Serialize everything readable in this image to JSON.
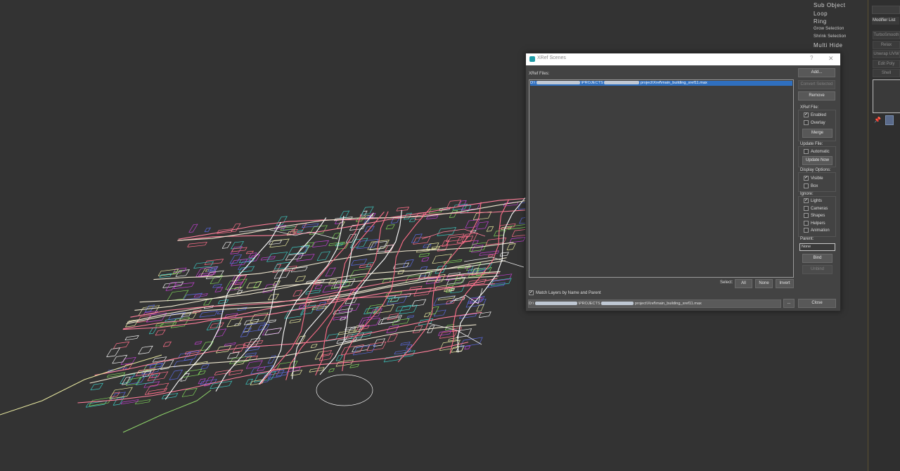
{
  "dialog": {
    "title": "XRef Scenes",
    "help": "?",
    "close_glyph": "✕",
    "files_label": "XRef Files:",
    "file_row": {
      "prefix": "D:\\",
      "segment_a": "\\PROJECTS",
      "suffix": "project\\Xref\\main_building_xref11.max"
    },
    "buttons": {
      "add": "Add...",
      "convert": "Convert Selected",
      "remove": "Remove",
      "merge": "Merge",
      "update_now": "Update Now",
      "bind": "Bind",
      "unbind": "Unbind",
      "all": "All",
      "none": "None",
      "invert": "Invert",
      "browse": "...",
      "close": "Close"
    },
    "xref_file": {
      "label": "XRef File:",
      "enabled": {
        "label": "Enabled",
        "checked": true
      },
      "overlay": {
        "label": "Overlay",
        "checked": false
      }
    },
    "update_file": {
      "label": "Update File:",
      "automatic": {
        "label": "Automatic",
        "checked": false
      }
    },
    "display_options": {
      "label": "Display Options:",
      "visible": {
        "label": "Visible",
        "checked": true
      },
      "box": {
        "label": "Box",
        "checked": false
      }
    },
    "ignore": {
      "label": "Ignore:",
      "lights": {
        "label": "Lights",
        "checked": true
      },
      "cameras": {
        "label": "Cameras",
        "checked": false
      },
      "shapes": {
        "label": "Shapes",
        "checked": false
      },
      "helpers": {
        "label": "Helpers",
        "checked": false
      },
      "animation": {
        "label": "Animation",
        "checked": false
      }
    },
    "parent": {
      "label": "Parent:",
      "value": "None"
    },
    "select_label": "Select:",
    "match_layers": {
      "label": "Match Layers by Name and Parent",
      "checked": true
    },
    "path": {
      "prefix": "D:\\",
      "segment_a": "\\PROJECTS",
      "suffix": "project\\Xref\\main_building_xref11.max"
    }
  },
  "command_list": [
    {
      "label": "Sub Object",
      "small": false
    },
    {
      "label": "Loop",
      "small": false
    },
    {
      "label": "Ring",
      "small": false
    },
    {
      "label": "Grow Selection",
      "small": true
    },
    {
      "label": "Shrink Selection",
      "small": true
    },
    {
      "label": "Multi Hide",
      "small": false
    }
  ],
  "modifier_panel": {
    "list_label": "Modifier List",
    "buttons": [
      "TurboSmooth",
      "Relax",
      "Unwrap UVW",
      "Edit Poly",
      "Shell"
    ]
  },
  "colors": {
    "viewport_bg": "#333333",
    "selection": "#2f6fbf",
    "map_lines": [
      "#ff6f8a",
      "#e8e8a0",
      "#7fd45a",
      "#c040d0",
      "#5a6adf",
      "#3dc7c0",
      "#f0f0f0"
    ]
  }
}
